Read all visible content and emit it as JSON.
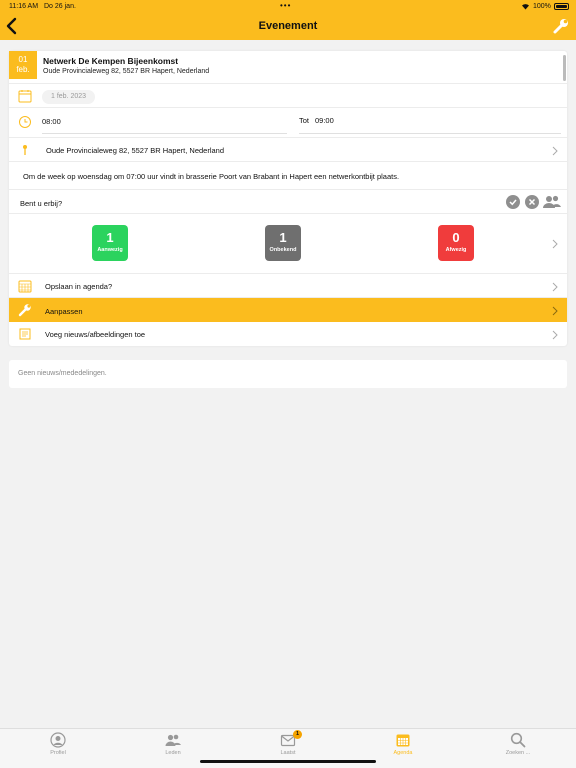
{
  "status_bar": {
    "time": "11:16 AM",
    "date": "Do 26 jan.",
    "battery": "100%"
  },
  "header": {
    "title": "Evenement"
  },
  "event": {
    "day": "01",
    "month": "feb.",
    "title": "Netwerk De Kempen Bijeenkomst",
    "address": "Oude Provincialeweg 82, 5527 BR Hapert, Nederland",
    "date_label": "1 feb. 2023",
    "start_time": "08:00",
    "end_label": "Tot",
    "end_time": "09:00",
    "location": "Oude Provincialeweg 82, 5527 BR Hapert, Nederland",
    "description": "Om de week op woensdag om 07:00 uur vindt in brasserie Poort van Brabant in Hapert een netwerkontbijt plaats.",
    "attend_question": "Bent u erbij?"
  },
  "counters": [
    {
      "value": "1",
      "label": "Aanwezig",
      "color": "#2bd35e"
    },
    {
      "value": "1",
      "label": "Onbekend",
      "color": "#6f6f6f"
    },
    {
      "value": "0",
      "label": "Afwezig",
      "color": "#f03c3c"
    }
  ],
  "actions": {
    "save_agenda": "Opslaan in agenda?",
    "edit": "Aanpassen",
    "add_news": "Voeg nieuws/afbeeldingen toe"
  },
  "news": {
    "empty_text": "Geen nieuws/mededelingen."
  },
  "tabs": [
    {
      "label": "Profiel",
      "icon": "profile-icon"
    },
    {
      "label": "Leden",
      "icon": "members-icon"
    },
    {
      "label": "Laatst",
      "icon": "inbox-icon",
      "badge": "1"
    },
    {
      "label": "Agenda",
      "icon": "calendar-icon",
      "active": true
    },
    {
      "label": "Zoeken ...",
      "icon": "search-icon"
    }
  ],
  "colors": {
    "accent": "#fbbc1e",
    "present": "#2bd35e",
    "unknown": "#6f6f6f",
    "absent": "#f03c3c"
  }
}
